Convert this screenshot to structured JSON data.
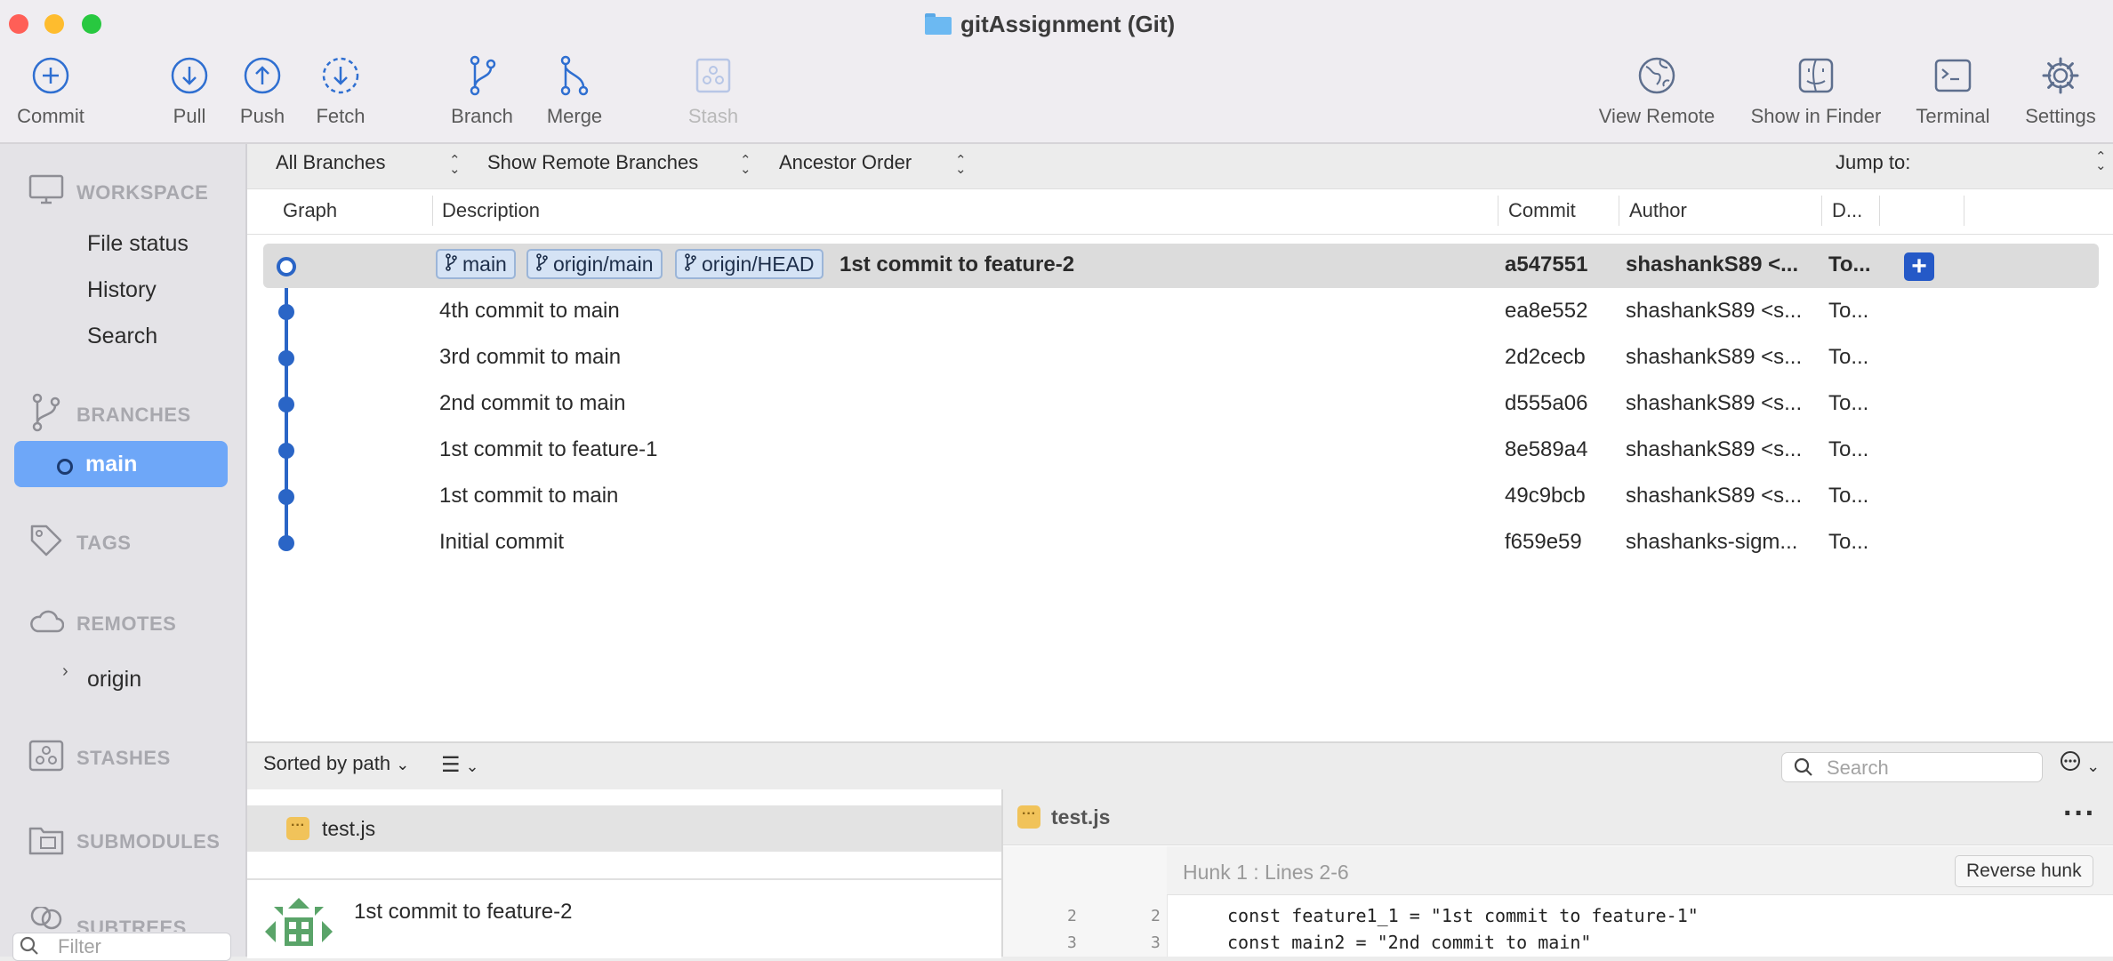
{
  "window": {
    "title": "gitAssignment (Git)"
  },
  "toolbar": {
    "commit": "Commit",
    "pull": "Pull",
    "push": "Push",
    "fetch": "Fetch",
    "branch": "Branch",
    "merge": "Merge",
    "stash": "Stash",
    "view_remote": "View Remote",
    "show_in_finder": "Show in Finder",
    "terminal": "Terminal",
    "settings": "Settings"
  },
  "sidebar": {
    "workspace": "WORKSPACE",
    "workspace_items": [
      "File status",
      "History",
      "Search"
    ],
    "branches": "BRANCHES",
    "branch_selected": "main",
    "tags": "TAGS",
    "remotes": "REMOTES",
    "remote_items": [
      "origin"
    ],
    "stashes": "STASHES",
    "submodules": "SUBMODULES",
    "subtrees": "SUBTREES",
    "filter_placeholder": "Filter"
  },
  "filters": {
    "branches": "All Branches",
    "remote": "Show Remote Branches",
    "order": "Ancestor Order",
    "jump_to": "Jump to:"
  },
  "columns": {
    "graph": "Graph",
    "description": "Description",
    "commit": "Commit",
    "author": "Author",
    "date": "D..."
  },
  "refs": [
    "main",
    "origin/main",
    "origin/HEAD"
  ],
  "commits": [
    {
      "description": "1st commit to feature-2",
      "hash": "a547551",
      "author": "shashankS89 <...",
      "date": "To..."
    },
    {
      "description": "4th commit to main",
      "hash": "ea8e552",
      "author": "shashankS89 <s...",
      "date": "To..."
    },
    {
      "description": "3rd commit to main",
      "hash": "2d2cecb",
      "author": "shashankS89 <s...",
      "date": "To..."
    },
    {
      "description": "2nd commit to main",
      "hash": "d555a06",
      "author": "shashankS89 <s...",
      "date": "To..."
    },
    {
      "description": "1st commit to feature-1",
      "hash": "8e589a4",
      "author": "shashankS89 <s...",
      "date": "To..."
    },
    {
      "description": "1st commit to main",
      "hash": "49c9bcb",
      "author": "shashankS89 <s...",
      "date": "To..."
    },
    {
      "description": "Initial commit",
      "hash": "f659e59",
      "author": "shashanks-sigm...",
      "date": "To..."
    }
  ],
  "bottom": {
    "sort_label": "Sorted by path",
    "search_placeholder": "Search",
    "files": [
      "test.js"
    ],
    "commit_message": "1st commit to feature-2",
    "diff_file": "test.js",
    "hunk_title": "Hunk 1 : Lines 2-6",
    "reverse_hunk": "Reverse hunk",
    "diff_lines": [
      {
        "old": "2",
        "new": "2",
        "code": "const feature1_1 = \"1st commit to feature-1\""
      },
      {
        "old": "3",
        "new": "3",
        "code": "const main2 = \"2nd commit to main\""
      }
    ]
  },
  "colors": {
    "accent": "#2a65c6",
    "selected_branch": "#6ea7f8",
    "toolbar_icon": "#2f6fd1"
  }
}
